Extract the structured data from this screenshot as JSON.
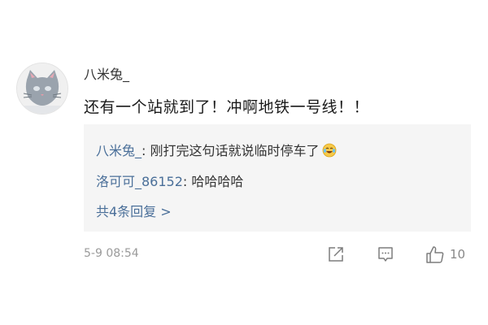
{
  "comment": {
    "username": "八米兔_",
    "content": "还有一个站就到了！冲啊地铁一号线！！",
    "timestamp": "5-9 08:54",
    "likes": "10",
    "avatar_icon": "cat-avatar"
  },
  "replies": [
    {
      "author": "八米兔_",
      "separator": ": ",
      "text": "刚打完这句话就说临时停车了",
      "emoji": "laugh-cry-emoji"
    },
    {
      "author": "洛可可_86152",
      "separator": ": ",
      "text": "哈哈哈哈"
    }
  ],
  "more_replies": "共4条回复 >",
  "colors": {
    "link": "#4a6f99",
    "reply_bg": "#f5f5f5",
    "muted": "#9a9a9a"
  }
}
